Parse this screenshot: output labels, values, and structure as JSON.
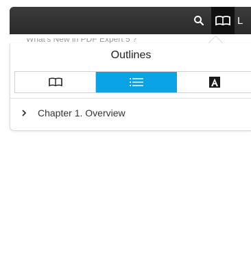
{
  "toolbar": {
    "search_icon": "search-icon",
    "book_icon": "book-icon",
    "more_label": "L",
    "colors": {
      "bg": "#2f2f2f",
      "active": "#111111"
    }
  },
  "background_text": "What's New in PDF Expert 5 ?",
  "popover": {
    "title": "Outlines",
    "tabs": [
      {
        "icon": "book-icon",
        "active": false
      },
      {
        "icon": "list-icon",
        "active": true
      },
      {
        "icon": "annotation-icon",
        "active": false
      }
    ],
    "accent_color": "#0aa3e6",
    "items": [
      {
        "label": "Chapter 1. Overview",
        "icon": "chevron-right-icon"
      }
    ]
  }
}
